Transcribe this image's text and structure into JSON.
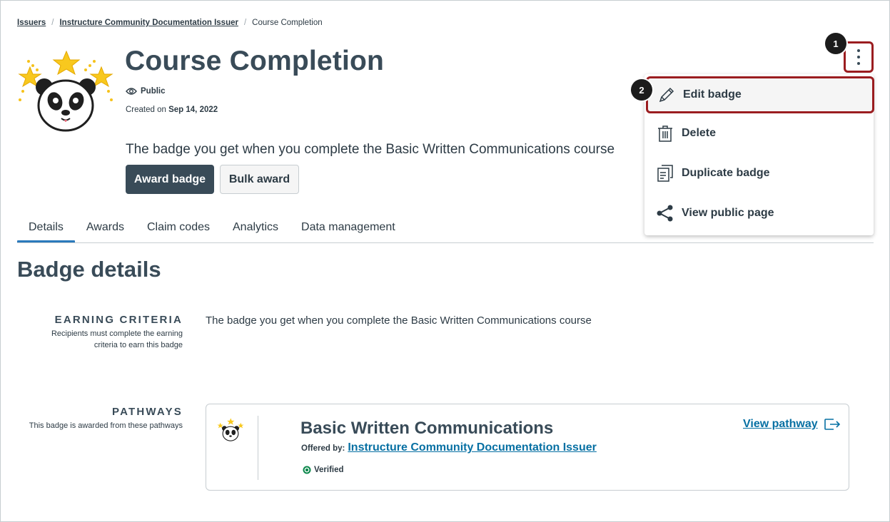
{
  "breadcrumb": {
    "items": [
      "Issuers",
      "Instructure Community Documentation Issuer"
    ],
    "current": "Course Completion"
  },
  "badge": {
    "title": "Course Completion",
    "visibility": "Public",
    "created_prefix": "Created on",
    "created_date": "Sep 14, 2022",
    "description": "The badge you get when you complete the Basic Written Communications course",
    "image_icon": "panda-stars-icon"
  },
  "actions": {
    "award_label": "Award badge",
    "bulk_award_label": "Bulk award"
  },
  "tabs": [
    {
      "label": "Details",
      "active": true
    },
    {
      "label": "Awards"
    },
    {
      "label": "Claim codes"
    },
    {
      "label": "Analytics"
    },
    {
      "label": "Data management"
    }
  ],
  "details": {
    "section_title": "Badge details",
    "earning_criteria": {
      "label": "EARNING CRITERIA",
      "sublabel": "Recipients must complete the earning criteria to earn this badge",
      "text": "The badge you get when you complete the Basic Written Communications course"
    },
    "pathways": {
      "label": "PATHWAYS",
      "sublabel": "This badge is awarded from these pathways",
      "card": {
        "name": "Basic Written Communications",
        "offered_by_label": "Offered by:",
        "issuer": "Instructure Community Documentation Issuer",
        "status": "Verified",
        "view_link": "View pathway"
      }
    }
  },
  "menu": {
    "items": [
      {
        "label": "Edit badge",
        "icon": "pencil-icon"
      },
      {
        "label": "Delete",
        "icon": "trash-icon"
      },
      {
        "label": "Duplicate badge",
        "icon": "duplicate-icon"
      },
      {
        "label": "View public page",
        "icon": "share-icon"
      }
    ]
  },
  "callouts": [
    "1",
    "2"
  ],
  "colors": {
    "primary": "#394b58",
    "link": "#0770a3",
    "highlight": "#9b1d20",
    "tab_active": "#2b7abc",
    "verified": "#0b874b"
  }
}
